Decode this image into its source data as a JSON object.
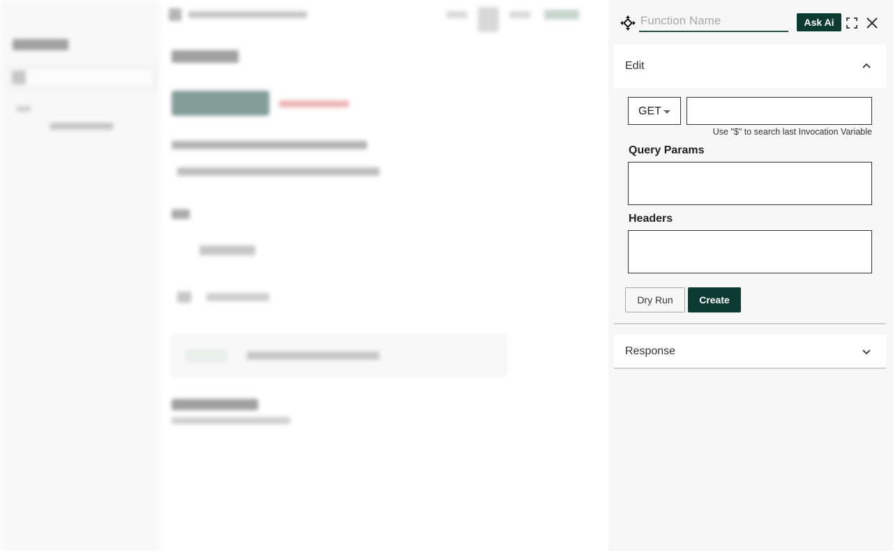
{
  "panel": {
    "function_name_placeholder": "Function Name",
    "function_name_value": "",
    "ask_ai_label": "Ask Ai",
    "icons": {
      "logo": "diamond-arrows-icon",
      "expand": "fullscreen-icon",
      "close": "close-icon"
    },
    "edit_section": {
      "title": "Edit",
      "expanded": true,
      "method": "GET",
      "url_value": "",
      "hint": "Use \"$\" to search last Invocation Variable",
      "query_params_label": "Query Params",
      "headers_label": "Headers",
      "dry_run_label": "Dry Run",
      "create_label": "Create"
    },
    "response_section": {
      "title": "Response",
      "expanded": false
    }
  },
  "colors": {
    "primary": "#0d3b31",
    "panel_bg": "#f7f7f7"
  }
}
